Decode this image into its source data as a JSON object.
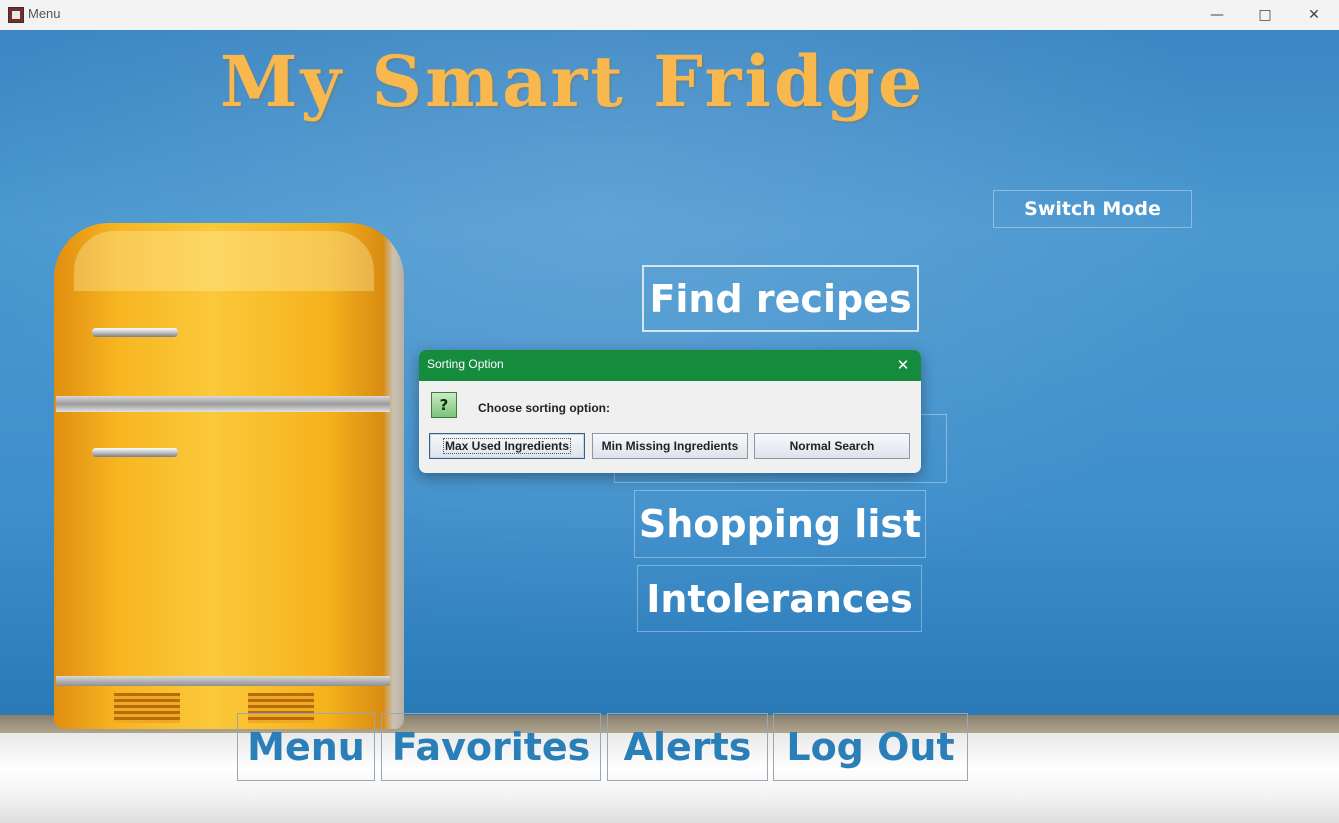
{
  "window": {
    "title": "Menu",
    "minimize_icon": "—",
    "maximize_icon": "□",
    "close_icon": "✕"
  },
  "app": {
    "heading": "My Smart Fridge",
    "switch_mode": "Switch Mode"
  },
  "main_menu": {
    "find_recipes": "Find recipes",
    "shopping_list": "Shopping list",
    "intolerances": "Intolerances"
  },
  "bottom_nav": {
    "menu": "Menu",
    "favorites": "Favorites",
    "alerts": "Alerts",
    "logout": "Log Out"
  },
  "dialog": {
    "title": "Sorting Option",
    "close_icon": "✕",
    "question_glyph": "?",
    "message": "Choose sorting option:",
    "buttons": {
      "max_used": "Max Used Ingredients",
      "min_missing": "Min Missing Ingredients",
      "normal": "Normal Search"
    },
    "accent_color": "#148b3d"
  },
  "colors": {
    "heading": "#f8b84e",
    "nav_text": "#2b7fb8",
    "wall": "#3f8fcb"
  }
}
